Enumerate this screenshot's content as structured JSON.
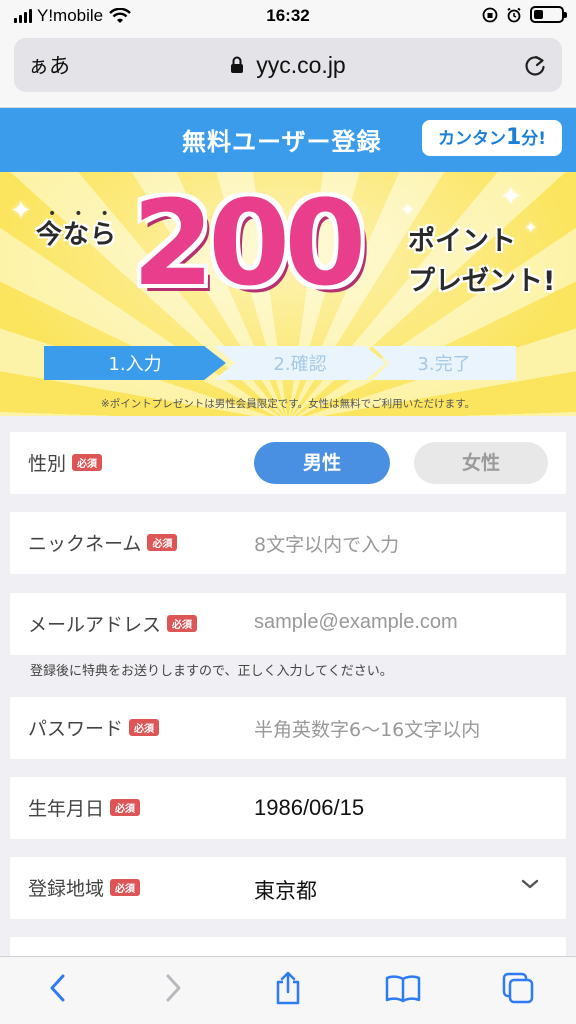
{
  "status_bar": {
    "carrier": "Y!mobile",
    "time": "16:32"
  },
  "browser": {
    "aa_label": "ぁあ",
    "url": "yyc.co.jp"
  },
  "header": {
    "title": "無料ユーザー登録",
    "badge_prefix": "カンタン",
    "badge_num": "1",
    "badge_suffix": "分!"
  },
  "promo": {
    "lead": "今なら",
    "points": "200",
    "line1": "ポイント",
    "line2": "プレゼント!",
    "notice": "※ポイントプレゼントは男性会員限定です。女性は無料でご利用いただけます。"
  },
  "steps": [
    "1.入力",
    "2.確認",
    "3.完了"
  ],
  "form": {
    "required_badge": "必須",
    "gender": {
      "label": "性別",
      "male": "男性",
      "female": "女性",
      "selected": "男性"
    },
    "nickname": {
      "label": "ニックネーム",
      "placeholder": "8文字以内で入力"
    },
    "email": {
      "label": "メールアドレス",
      "placeholder": "sample@example.com",
      "helper": "登録後に特典をお送りしますので、正しく入力してください。"
    },
    "password": {
      "label": "パスワード",
      "placeholder": "半角英数字6〜16文字以内"
    },
    "birthday": {
      "label": "生年月日",
      "value": "1986/06/15"
    },
    "region": {
      "label": "登録地域",
      "value": "東京都"
    }
  },
  "colors": {
    "accent": "#3b9cec",
    "pink": "#e83e8c",
    "required": "#dd5555"
  },
  "icons": [
    "back-icon",
    "forward-icon",
    "share-icon",
    "bookmarks-icon",
    "tabs-icon",
    "reload-icon",
    "lock-icon",
    "wifi-icon",
    "chevron-down-icon"
  ]
}
